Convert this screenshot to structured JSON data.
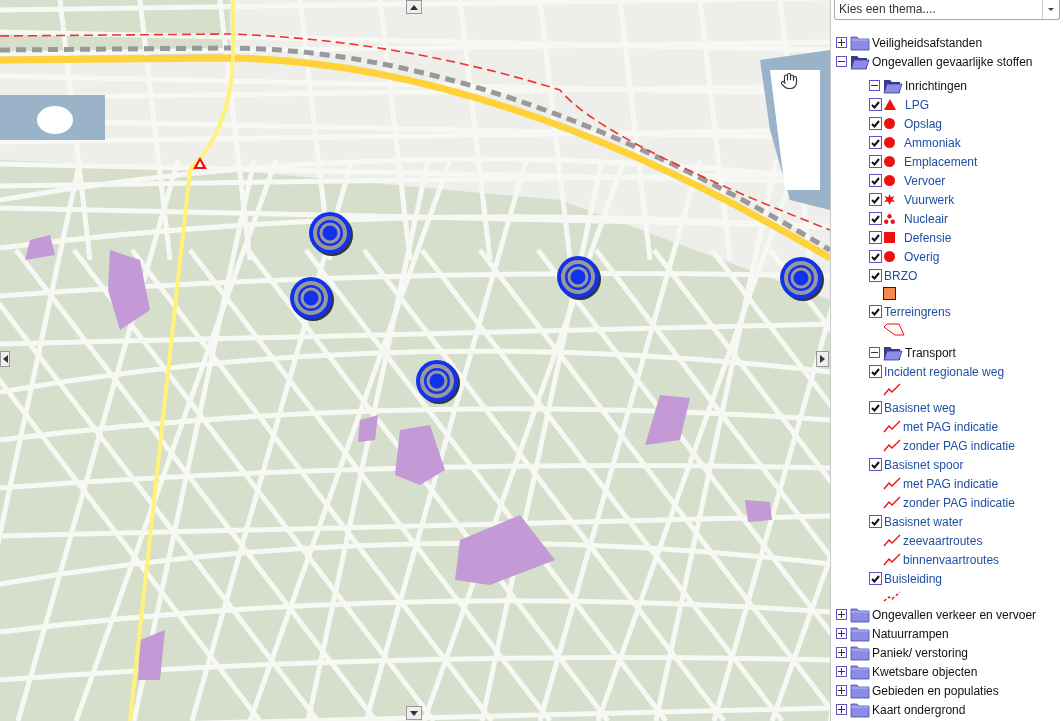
{
  "theme_select": {
    "placeholder": "Kies een thema...."
  },
  "tree": [
    {
      "kind": "folder",
      "label": "Veiligheidsafstanden",
      "expanded": false
    },
    {
      "kind": "folder",
      "label": "Ongevallen gevaarlijke stoffen",
      "expanded": true,
      "children": [
        {
          "kind": "folder",
          "label": "Inrichtingen",
          "expanded": true,
          "children": [
            {
              "kind": "layer",
              "label": "LPG",
              "checked": true,
              "marker": {
                "kind": "triangle"
              }
            },
            {
              "kind": "layer",
              "label": "Opslag",
              "checked": true,
              "marker": {
                "kind": "circle"
              }
            },
            {
              "kind": "layer",
              "label": "Ammoniak",
              "checked": true,
              "marker": {
                "kind": "circle"
              }
            },
            {
              "kind": "layer",
              "label": "Emplacement",
              "checked": true,
              "marker": {
                "kind": "circle"
              }
            },
            {
              "kind": "layer",
              "label": "Vervoer",
              "checked": true,
              "marker": {
                "kind": "circle"
              }
            },
            {
              "kind": "layer",
              "label": "Vuurwerk",
              "checked": true,
              "marker": {
                "kind": "star"
              }
            },
            {
              "kind": "layer",
              "label": "Nucleair",
              "checked": true,
              "marker": {
                "kind": "nuclear"
              }
            },
            {
              "kind": "layer",
              "label": "Defensie",
              "checked": true,
              "marker": {
                "kind": "square"
              }
            },
            {
              "kind": "layer",
              "label": "Overig",
              "checked": true,
              "marker": {
                "kind": "circle"
              }
            },
            {
              "kind": "layer",
              "label": "BRZO",
              "checked": true,
              "legend": [
                {
                  "kind": "orange-square"
                }
              ]
            },
            {
              "kind": "layer",
              "label": "Terreingrens",
              "checked": true,
              "legend": [
                {
                  "kind": "polygon"
                }
              ]
            }
          ]
        },
        {
          "kind": "folder",
          "label": "Transport",
          "expanded": true,
          "children": [
            {
              "kind": "layer",
              "label": "Incident regionale weg",
              "checked": true,
              "legend": [
                {
                  "kind": "line"
                }
              ]
            },
            {
              "kind": "layer",
              "label": "Basisnet weg",
              "checked": true,
              "legend": [
                {
                  "kind": "line",
                  "label": "met PAG indicatie"
                },
                {
                  "kind": "line",
                  "label": "zonder PAG indicatie"
                }
              ]
            },
            {
              "kind": "layer",
              "label": "Basisnet spoor",
              "checked": true,
              "legend": [
                {
                  "kind": "line",
                  "label": "met PAG indicatie"
                },
                {
                  "kind": "line",
                  "label": "zonder PAG indicatie"
                }
              ]
            },
            {
              "kind": "layer",
              "label": "Basisnet water",
              "checked": true,
              "legend": [
                {
                  "kind": "line",
                  "label": "zeevaartroutes"
                },
                {
                  "kind": "line",
                  "label": "binnenvaartroutes"
                }
              ]
            },
            {
              "kind": "layer",
              "label": "Buisleiding",
              "checked": true,
              "legend": [
                {
                  "kind": "dashed-line"
                }
              ]
            }
          ]
        }
      ]
    },
    {
      "kind": "folder",
      "label": "Ongevallen verkeer en vervoer",
      "expanded": false
    },
    {
      "kind": "folder",
      "label": "Natuurrampen",
      "expanded": false
    },
    {
      "kind": "folder",
      "label": "Paniek/ verstoring",
      "expanded": false
    },
    {
      "kind": "folder",
      "label": "Kwetsbare objecten",
      "expanded": false
    },
    {
      "kind": "folder",
      "label": "Gebieden en populaties",
      "expanded": false
    },
    {
      "kind": "folder",
      "label": "Kaart ondergrond",
      "expanded": false
    }
  ]
}
